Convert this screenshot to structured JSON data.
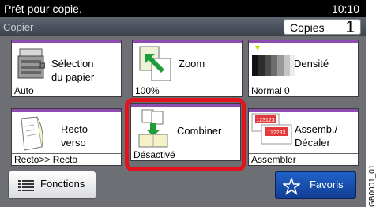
{
  "status_bar": {
    "message": "Prêt pour copie.",
    "time": "10:10"
  },
  "header": {
    "title": "Copier",
    "copies_label": "Copies",
    "copies_value": "1"
  },
  "tiles": [
    {
      "label": "Sélection\ndu papier",
      "status": "Auto",
      "icon": "paper-tray-icon"
    },
    {
      "label": "Zoom",
      "status": "100%",
      "icon": "zoom-icon"
    },
    {
      "label": "Densité",
      "status": "Normal 0",
      "icon": "density-icon"
    },
    {
      "label": "Recto\nverso",
      "status": "Recto>> Recto",
      "icon": "duplex-icon"
    },
    {
      "label": "Combiner",
      "status": "Désactivé",
      "icon": "combine-icon"
    },
    {
      "label": "Assemb./\nDécaler",
      "status": "Assembler",
      "icon": "collate-icon",
      "badges": [
        "123123",
        "112233"
      ]
    }
  ],
  "buttons": {
    "functions": "Fonctions",
    "favorites": "Favoris"
  },
  "watermark": "GB0001_01",
  "colors": {
    "highlight": "#e4121c",
    "tile_accent": "#8d4db0",
    "favorites_button": "#1a55b8"
  }
}
